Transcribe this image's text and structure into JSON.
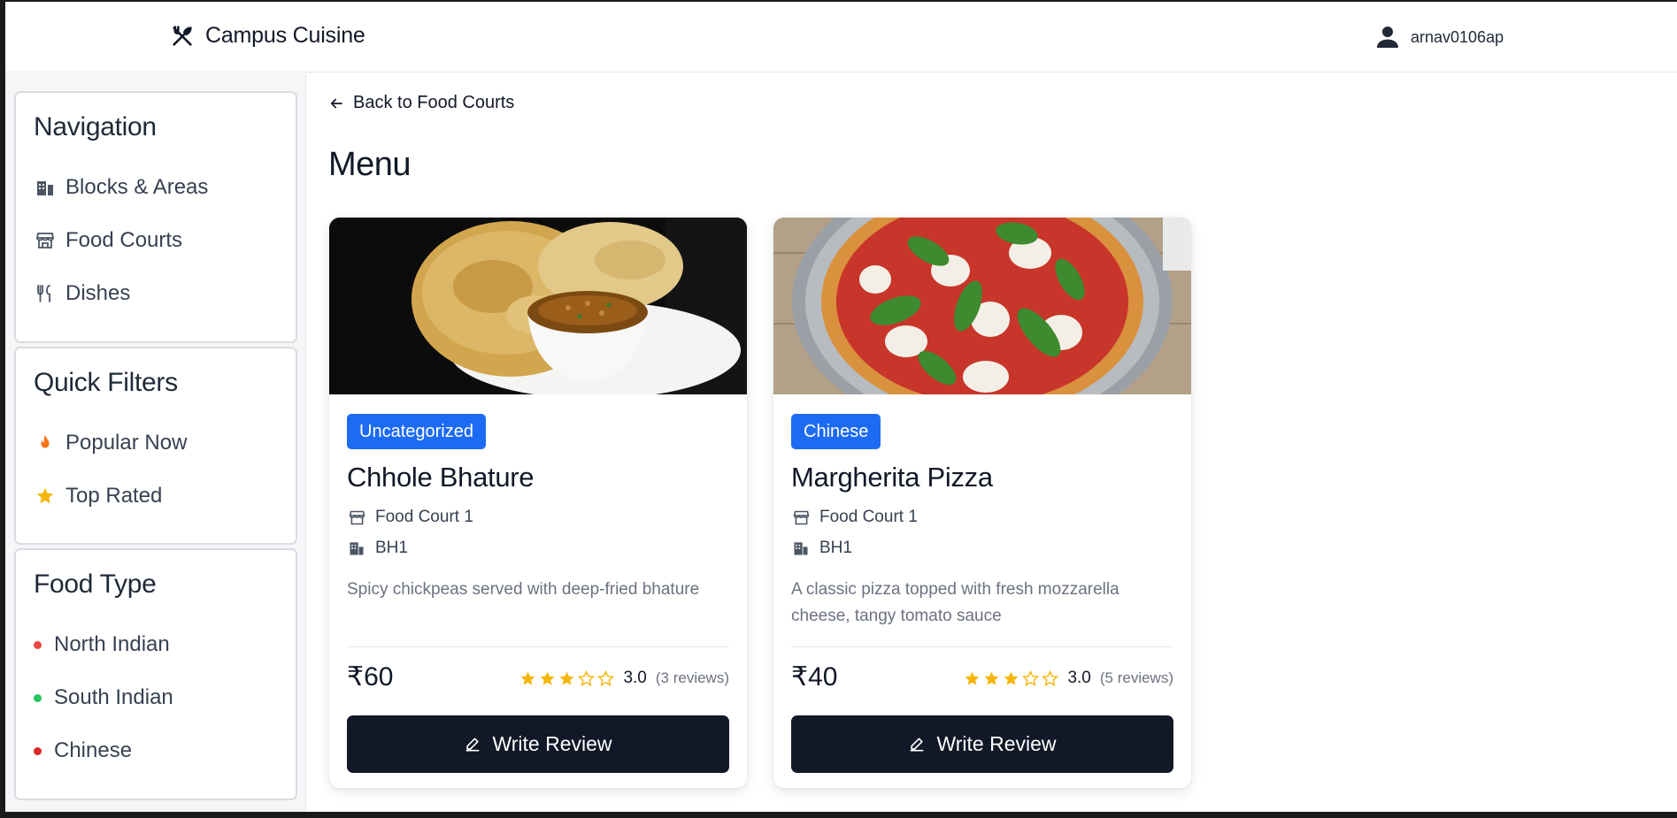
{
  "header": {
    "brand_name": "Campus Cuisine",
    "brand_icon": "utensils-crossed-icon",
    "username": "arnav0106ap",
    "user_icon": "user-icon"
  },
  "sidebar": {
    "navigation": {
      "title": "Navigation",
      "items": [
        {
          "label": "Blocks & Areas",
          "icon": "building-icon"
        },
        {
          "label": "Food Courts",
          "icon": "store-icon"
        },
        {
          "label": "Dishes",
          "icon": "utensils-icon"
        }
      ]
    },
    "quick_filters": {
      "title": "Quick Filters",
      "items": [
        {
          "label": "Popular Now",
          "icon": "flame-icon",
          "color": "#f97316"
        },
        {
          "label": "Top Rated",
          "icon": "star-icon",
          "color": "#f5b50a"
        }
      ]
    },
    "food_type": {
      "title": "Food Type",
      "items": [
        {
          "label": "North Indian",
          "color": "#ef4444"
        },
        {
          "label": "South Indian",
          "color": "#22c55e"
        },
        {
          "label": "Chinese",
          "color": "#dc2626"
        }
      ]
    }
  },
  "main": {
    "back_label": "Back to Food Courts",
    "page_title": "Menu",
    "write_review_label": "Write Review",
    "dishes": [
      {
        "category": "Uncategorized",
        "name": "Chhole Bhature",
        "food_court": "Food Court 1",
        "block": "BH1",
        "description": "Spicy chickpeas served with deep-fried bhature",
        "price": "₹60",
        "rating": "3.0",
        "rating_value": 3,
        "reviews": "(3 reviews)"
      },
      {
        "category": "Chinese",
        "name": "Margherita Pizza",
        "food_court": "Food Court 1",
        "block": "BH1",
        "description": "A classic pizza topped with fresh mozzarella cheese, tangy tomato sauce",
        "price": "₹40",
        "rating": "3.0",
        "rating_value": 3,
        "reviews": "(5 reviews)"
      }
    ]
  },
  "colors": {
    "accent": "#1d6bf3",
    "button_dark": "#111827",
    "star": "#f5b50a"
  }
}
